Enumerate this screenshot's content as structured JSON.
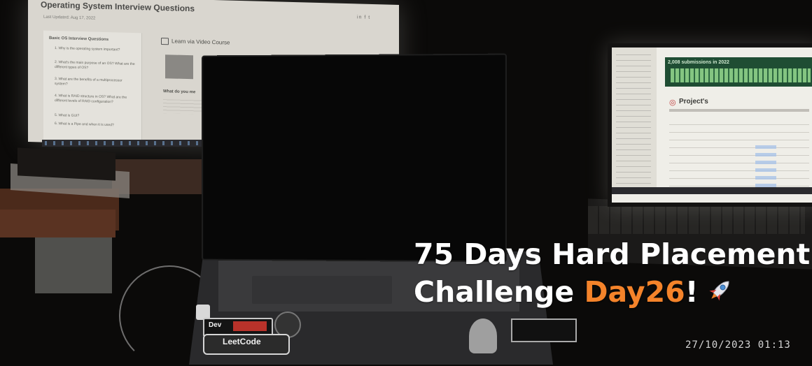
{
  "left_monitor": {
    "title": "Operating System Interview Questions",
    "updated": "Last Updated: Aug 17, 2022",
    "social": "in f t",
    "toc_heading": "Basic OS Interview Questions",
    "toc_items": [
      "1. Why is the operating system important?",
      "2. What's the main purpose of an OS? What are the different types of OS?",
      "3. What are the benefits of a multiprocessor system?",
      "4. What is RAID structure in OS? What are the different levels of RAID configuration?",
      "5. What is GUI?",
      "6. What is a Pipe and when it is used?"
    ],
    "course_label": "Learn via Video Course",
    "what_heading": "What do you me"
  },
  "right_screen": {
    "banner_text": "2,008 submissions in 2022",
    "project_title": "Project's"
  },
  "stickers": {
    "dev_label": "Dev",
    "leet_label": "LeetCode"
  },
  "overlay": {
    "line1": "75 Days Hard Placement",
    "line2_prefix": "Challenge ",
    "line2_accent": "Day26",
    "line2_suffix": "!",
    "emoji": "rocket-icon",
    "accent_color": "#f4832a",
    "timestamp": "27/10/2023  01:13"
  }
}
